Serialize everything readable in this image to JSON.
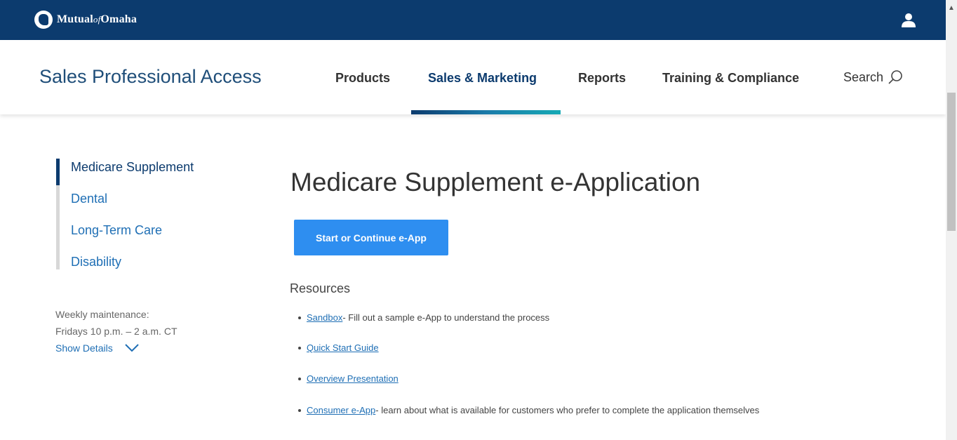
{
  "brand": {
    "logo_text": "MutualofOmaha",
    "primary_color": "#0c3b6e",
    "accent_color": "#2e8ef0",
    "link_color": "#1f6fb5"
  },
  "header": {
    "site_title": "Sales Professional Access",
    "nav": [
      {
        "label": "Products",
        "active": false
      },
      {
        "label": "Sales & Marketing",
        "active": true
      },
      {
        "label": "Reports",
        "active": false
      },
      {
        "label": "Training & Compliance",
        "active": false
      }
    ],
    "search_label": "Search",
    "search_icon": "magnifier-icon",
    "user_icon": "user-icon"
  },
  "sidebar": {
    "items": [
      {
        "label": "Medicare Supplement",
        "active": true
      },
      {
        "label": "Dental",
        "active": false
      },
      {
        "label": "Long-Term Care",
        "active": false
      },
      {
        "label": "Disability",
        "active": false
      }
    ],
    "maintenance_line1": "Weekly maintenance:",
    "maintenance_line2": "Fridays 10 p.m. – 2 a.m. CT",
    "show_details": "Show Details"
  },
  "main": {
    "title": "Medicare Supplement e-Application",
    "cta_label": "Start or Continue e-App",
    "resources_title": "Resources",
    "resources": [
      {
        "link": "Sandbox",
        "desc": " - Fill out a sample e-App to understand the process"
      },
      {
        "link": "Quick Start Guide",
        "desc": ""
      },
      {
        "link": "Overview Presentation",
        "desc": ""
      },
      {
        "link": "Consumer e-App",
        "desc": " - learn about what is available for customers who prefer to complete the application themselves"
      }
    ]
  }
}
